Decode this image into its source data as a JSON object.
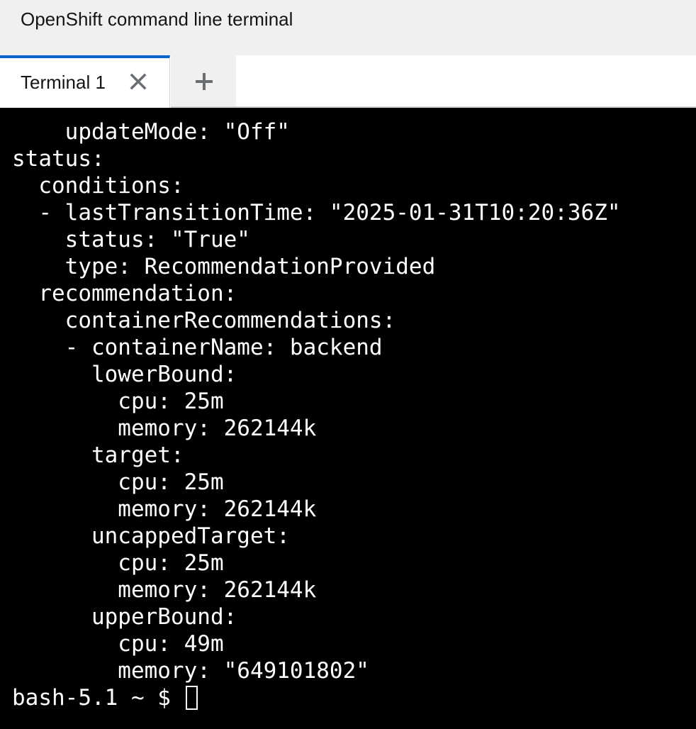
{
  "header": {
    "title": "OpenShift command line terminal"
  },
  "tabs": [
    {
      "label": "Terminal 1",
      "active": true
    }
  ],
  "icons": {
    "close_tab": "close-icon",
    "add_tab": "plus-icon"
  },
  "colors": {
    "header_bg": "#f0f0f0",
    "active_tab_accent": "#0066cc",
    "terminal_bg": "#000000",
    "terminal_fg": "#ffffff"
  },
  "terminal": {
    "lines": [
      "    updateMode: \"Off\"",
      "status:",
      "  conditions:",
      "  - lastTransitionTime: \"2025-01-31T10:20:36Z\"",
      "    status: \"True\"",
      "    type: RecommendationProvided",
      "  recommendation:",
      "    containerRecommendations:",
      "    - containerName: backend",
      "      lowerBound:",
      "        cpu: 25m",
      "        memory: 262144k",
      "      target:",
      "        cpu: 25m",
      "        memory: 262144k",
      "      uncappedTarget:",
      "        cpu: 25m",
      "        memory: 262144k",
      "      upperBound:",
      "        cpu: 49m",
      "        memory: \"649101802\""
    ],
    "prompt": "bash-5.1 ~ $ "
  }
}
